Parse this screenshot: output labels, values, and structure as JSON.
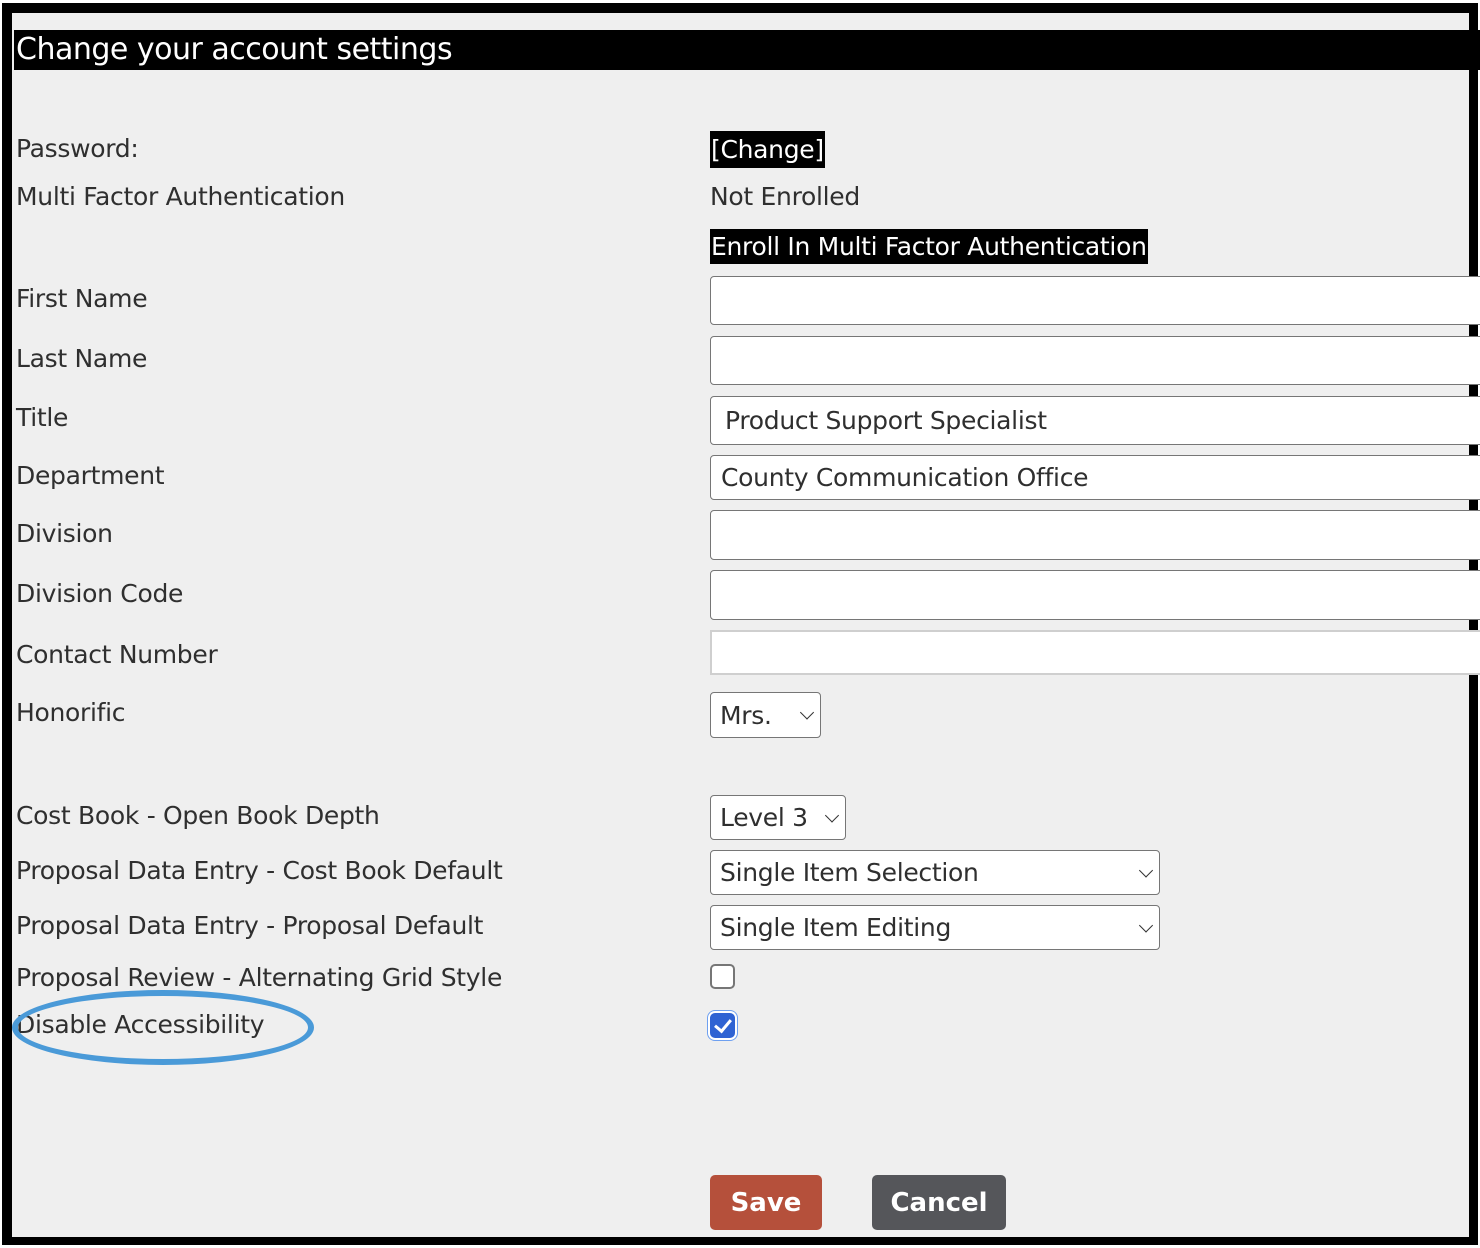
{
  "page": {
    "title": "Change your account settings"
  },
  "fields": {
    "password": {
      "label": "Password:",
      "action_label": "[Change]"
    },
    "mfa": {
      "label": "Multi Factor Authentication",
      "status": "Not Enrolled",
      "enroll_label": "Enroll In Multi Factor Authentication"
    },
    "first_name": {
      "label": "First Name",
      "value": ""
    },
    "last_name": {
      "label": "Last Name",
      "value": ""
    },
    "title": {
      "label": "Title",
      "value": "Product Support Specialist"
    },
    "department": {
      "label": "Department",
      "value": "County Communication Office"
    },
    "division": {
      "label": "Division",
      "value": ""
    },
    "division_code": {
      "label": "Division Code",
      "value": ""
    },
    "contact_number": {
      "label": "Contact Number",
      "value": ""
    },
    "honorific": {
      "label": "Honorific",
      "selected": "Mrs."
    },
    "cost_book_depth": {
      "label": "Cost Book - Open Book Depth",
      "selected": "Level 3"
    },
    "cost_book_default": {
      "label": "Proposal Data Entry - Cost Book Default",
      "selected": "Single Item Selection"
    },
    "proposal_default": {
      "label": "Proposal Data Entry - Proposal Default",
      "selected": "Single Item Editing"
    },
    "alternating_grid": {
      "label": "Proposal Review - Alternating Grid Style",
      "checked": false
    },
    "disable_accessibility": {
      "label": "Disable Accessibility",
      "checked": true
    }
  },
  "actions": {
    "save_label": "Save",
    "cancel_label": "Cancel"
  },
  "colors": {
    "save": "#b5503b",
    "cancel": "#55565a",
    "annotation": "#4a9ad8",
    "checkbox_checked": "#2f63d3"
  }
}
